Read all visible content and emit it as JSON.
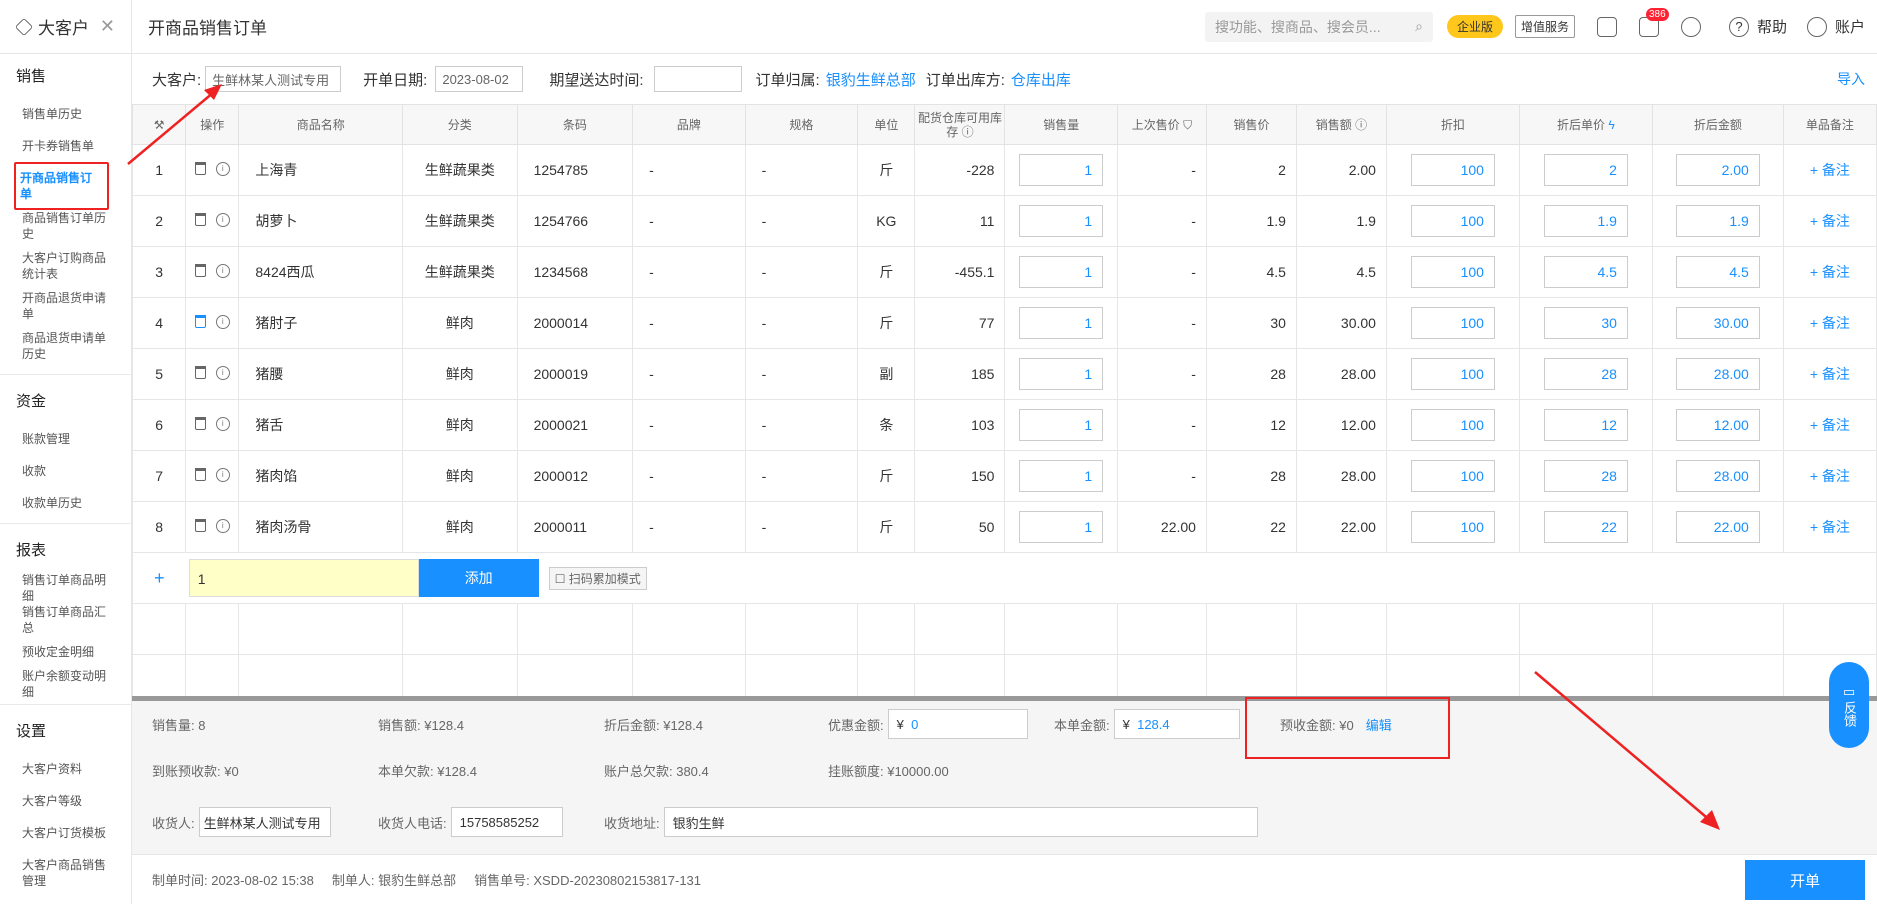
{
  "sidebar": {
    "brand": "大客户",
    "sections": [
      {
        "title": "销售",
        "items": [
          "销售单历史",
          "开卡券销售单",
          "开商品销售订单",
          "商品销售订单历史",
          "大客户订购商品统计表",
          "开商品退货申请单",
          "商品退货申请单历史"
        ]
      },
      {
        "title": "资金",
        "items": [
          "账款管理",
          "收款",
          "收款单历史"
        ]
      },
      {
        "title": "报表",
        "items": [
          "销售订单商品明细",
          "销售订单商品汇总",
          "预收定金明细",
          "账户余额变动明细"
        ]
      },
      {
        "title": "设置",
        "items": [
          "大客户资料",
          "大客户等级",
          "大客户订货模板",
          "大客户商品销售管理"
        ]
      }
    ]
  },
  "header": {
    "title": "开商品销售订单",
    "search_placeholder": "搜功能、搜商品、搜会员...",
    "enterprise": "企业版",
    "value_service": "增值服务",
    "notif_count": "386",
    "help": "帮助",
    "account": "账户"
  },
  "form": {
    "customer_label": "大客户:",
    "customer_value": "生鲜林某人测试专用",
    "date_label": "开单日期:",
    "date_value": "2023-08-02",
    "expected_label": "期望送达时间:",
    "expected_value": "",
    "belong_label": "订单归属:",
    "belong_value": "银豹生鲜总部",
    "warehouse_label": "订单出库方:",
    "warehouse_value": "仓库出库",
    "import": "导入"
  },
  "table": {
    "headers": [
      "操作",
      "商品名称",
      "分类",
      "条码",
      "品牌",
      "规格",
      "单位",
      "配货仓库可用库存",
      "销售量",
      "上次售价",
      "销售价",
      "销售额",
      "折扣",
      "折后单价",
      "折后金额",
      "单品备注"
    ],
    "rows": [
      {
        "no": "1",
        "name": "上海青",
        "cat": "生鲜蔬果类",
        "code": "1254785",
        "brand": "-",
        "spec": "-",
        "unit": "斤",
        "stock": "-228",
        "qty": "1",
        "last": "-",
        "price": "2",
        "amount": "2.00",
        "disc": "100",
        "dprice": "2",
        "damount": "2.00",
        "note": "+ 备注"
      },
      {
        "no": "2",
        "name": "胡萝卜",
        "cat": "生鲜蔬果类",
        "code": "1254766",
        "brand": "-",
        "spec": "-",
        "unit": "KG",
        "stock": "11",
        "qty": "1",
        "last": "-",
        "price": "1.9",
        "amount": "1.9",
        "disc": "100",
        "dprice": "1.9",
        "damount": "1.9",
        "note": "+ 备注"
      },
      {
        "no": "3",
        "name": "8424西瓜",
        "cat": "生鲜蔬果类",
        "code": "1234568",
        "brand": "-",
        "spec": "-",
        "unit": "斤",
        "stock": "-455.1",
        "qty": "1",
        "last": "-",
        "price": "4.5",
        "amount": "4.5",
        "disc": "100",
        "dprice": "4.5",
        "damount": "4.5",
        "note": "+ 备注"
      },
      {
        "no": "4",
        "name": "猪肘子",
        "cat": "鲜肉",
        "code": "2000014",
        "brand": "-",
        "spec": "-",
        "unit": "斤",
        "stock": "77",
        "qty": "1",
        "last": "-",
        "price": "30",
        "amount": "30.00",
        "disc": "100",
        "dprice": "30",
        "damount": "30.00",
        "note": "+ 备注"
      },
      {
        "no": "5",
        "name": "猪腰",
        "cat": "鲜肉",
        "code": "2000019",
        "brand": "-",
        "spec": "-",
        "unit": "副",
        "stock": "185",
        "qty": "1",
        "last": "-",
        "price": "28",
        "amount": "28.00",
        "disc": "100",
        "dprice": "28",
        "damount": "28.00",
        "note": "+ 备注"
      },
      {
        "no": "6",
        "name": "猪舌",
        "cat": "鲜肉",
        "code": "2000021",
        "brand": "-",
        "spec": "-",
        "unit": "条",
        "stock": "103",
        "qty": "1",
        "last": "-",
        "price": "12",
        "amount": "12.00",
        "disc": "100",
        "dprice": "12",
        "damount": "12.00",
        "note": "+ 备注"
      },
      {
        "no": "7",
        "name": "猪肉馅",
        "cat": "鲜肉",
        "code": "2000012",
        "brand": "-",
        "spec": "-",
        "unit": "斤",
        "stock": "150",
        "qty": "1",
        "last": "-",
        "price": "28",
        "amount": "28.00",
        "disc": "100",
        "dprice": "28",
        "damount": "28.00",
        "note": "+ 备注"
      },
      {
        "no": "8",
        "name": "猪肉汤骨",
        "cat": "鲜肉",
        "code": "2000011",
        "brand": "-",
        "spec": "-",
        "unit": "斤",
        "stock": "50",
        "qty": "1",
        "last": "22.00",
        "price": "22",
        "amount": "22.00",
        "disc": "100",
        "dprice": "22",
        "damount": "22.00",
        "note": "+ 备注"
      }
    ],
    "add_value": "1",
    "add_button": "添加",
    "scan_mode": "扫码累加模式"
  },
  "summary": {
    "sales_qty": "销售量: 8",
    "sales_amount": "销售额: ¥128.4",
    "disc_amount": "折后金额: ¥128.4",
    "discount_label": "优惠金额:",
    "discount_value": "0",
    "order_label": "本单金额:",
    "order_value": "128.4",
    "prepaid": "预收金额: ¥0",
    "edit": "编辑",
    "arrived": "到账预收款: ¥0",
    "owed": "本单欠款: ¥128.4",
    "total_owed": "账户总欠款: 380.4",
    "credit": "挂账额度: ¥10000.00",
    "receiver_label": "收货人:",
    "receiver_value": "生鲜林某人测试专用",
    "phone_label": "收货人电话:",
    "phone_value": "15758585252",
    "address_label": "收货地址:",
    "address_value": "银豹生鲜"
  },
  "bottom": {
    "time": "制单时间: 2023-08-02 15:38",
    "maker": "制单人: 银豹生鲜总部",
    "number": "销售单号: XSDD-20230802153817-131",
    "submit": "开单",
    "feedback": "反馈"
  }
}
